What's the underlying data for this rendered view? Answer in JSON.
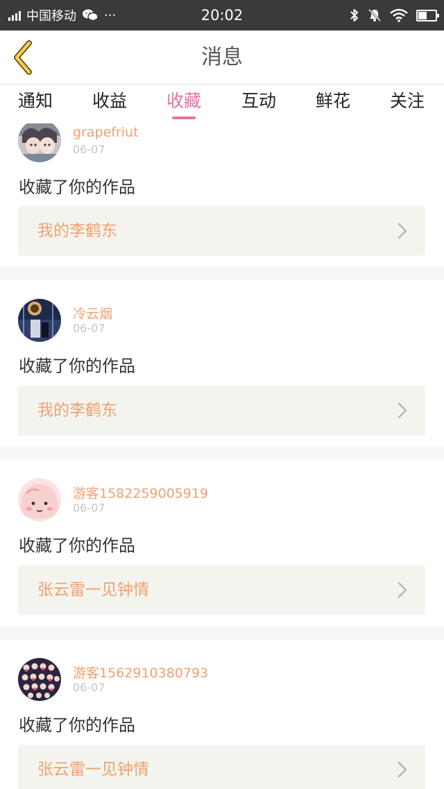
{
  "status_bar": {
    "carrier": "中国移动",
    "more": "···",
    "time": "20:02"
  },
  "nav": {
    "title": "消息"
  },
  "tabs": [
    {
      "label": "通知",
      "active": false
    },
    {
      "label": "收益",
      "active": false
    },
    {
      "label": "收藏",
      "active": true
    },
    {
      "label": "互动",
      "active": false
    },
    {
      "label": "鲜花",
      "active": false
    },
    {
      "label": "关注",
      "active": false
    }
  ],
  "items": [
    {
      "user": "grapefriut",
      "date": "06-07",
      "action": "收藏了你的作品",
      "work": "我的李鹤东"
    },
    {
      "user": "冷云烟",
      "date": "06-07",
      "action": "收藏了你的作品",
      "work": "我的李鹤东"
    },
    {
      "user": "游客1582259005919",
      "date": "06-07",
      "action": "收藏了你的作品",
      "work": "张云雷一见钟情"
    },
    {
      "user": "游客1562910380793",
      "date": "06-07",
      "action": "收藏了你的作品",
      "work": "张云雷一见钟情"
    }
  ],
  "colors": {
    "accent_pink": "#e573a4",
    "username_orange": "#f0a070",
    "status_bar_bg": "#3a3a3a",
    "back_arrow_yellow": "#f2d045"
  }
}
